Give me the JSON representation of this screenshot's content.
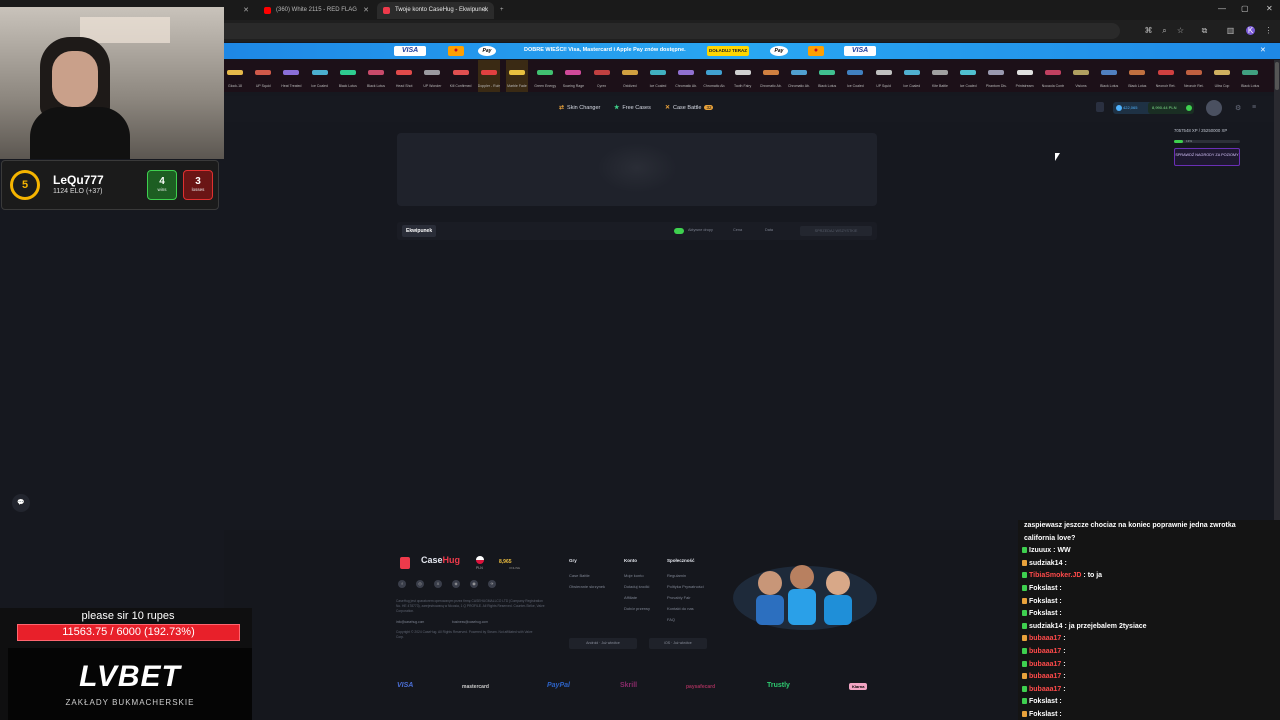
{
  "browser": {
    "tabs": [
      {
        "label": "",
        "active": false
      },
      {
        "label": "(360) White 2115 - RED FLAG",
        "active": false
      },
      {
        "label": "Twoje konto CaseHug - Ekwipunek",
        "active": true
      }
    ],
    "new_tab": "+"
  },
  "banner": {
    "text": "DOBRE WIEŚCI! Visa, Mastercard i Apple Pay znów dostępne.",
    "button": "DOŁADUJ TERAZ",
    "cards": [
      "VISA",
      "Pay",
      "Pay",
      "VISA"
    ]
  },
  "skins": [
    {
      "name": "Glock-18",
      "color": "#e6b84a"
    },
    {
      "name": "UP Squid",
      "color": "#d05a4a"
    },
    {
      "name": "Heat Treated",
      "color": "#8a6fd8"
    },
    {
      "name": "Ice Coaled",
      "color": "#4bb0d0"
    },
    {
      "name": "Black Lotus",
      "color": "#2ecc90"
    },
    {
      "name": "Black Lotus",
      "color": "#c84a6a"
    },
    {
      "name": "Head Shot",
      "color": "#e04a4a"
    },
    {
      "name": "UP Wonder",
      "color": "#9a9aa0"
    },
    {
      "name": "Kill Confirmed",
      "color": "#e05050"
    },
    {
      "name": "Doppler - Ruby",
      "color": "#e04040"
    },
    {
      "name": "Marble Fade",
      "color": "#e8c040"
    },
    {
      "name": "Green Energy",
      "color": "#40c070"
    },
    {
      "name": "Soaring Rage",
      "color": "#d04a9a"
    },
    {
      "name": "Cyrex",
      "color": "#c04040"
    },
    {
      "name": "Oxidized",
      "color": "#d0a040"
    },
    {
      "name": "Ice Coaled",
      "color": "#40b0c0"
    },
    {
      "name": "Chromatic Ab.",
      "color": "#9070d0"
    },
    {
      "name": "Chromatic Ab.",
      "color": "#40a0d0"
    },
    {
      "name": "Tooth Fairy",
      "color": "#d0d0d0"
    },
    {
      "name": "Chromatic Ab.",
      "color": "#d08040"
    },
    {
      "name": "Chromatic Ab.",
      "color": "#50a0d0"
    },
    {
      "name": "Black Lotus",
      "color": "#40c090"
    },
    {
      "name": "Ice Coaled",
      "color": "#4080c0"
    },
    {
      "name": "UP Squid",
      "color": "#c0c0c0"
    },
    {
      "name": "Ice Coaled",
      "color": "#50b0d0"
    },
    {
      "name": "Kite Battle",
      "color": "#a0a0a0"
    },
    {
      "name": "Ice Coaled",
      "color": "#50c0d0"
    },
    {
      "name": "Phantom Dis.",
      "color": "#9a9ab0"
    },
    {
      "name": "Printstream",
      "color": "#e0e0e0"
    },
    {
      "name": "Nocaola Control",
      "color": "#c04060"
    },
    {
      "name": "Visions",
      "color": "#b0a060"
    },
    {
      "name": "Black Lotus",
      "color": "#5080c0"
    },
    {
      "name": "Black Lotus",
      "color": "#c07040"
    },
    {
      "name": "Neonoir Ret.",
      "color": "#d04040"
    },
    {
      "name": "Neonoir Ret.",
      "color": "#c06040"
    },
    {
      "name": "Ultra Cop",
      "color": "#d0b060"
    },
    {
      "name": "Black Lotus",
      "color": "#40a080"
    }
  ],
  "nav": {
    "links": [
      "Skin Changer",
      "Free Cases",
      "Case Battle"
    ],
    "battle_count": "32",
    "balance_coins": "422,065",
    "balance_pln": "8,990.44 PLN"
  },
  "xp": {
    "value": "7057548 XP / 25250000 XP",
    "percent": "13%",
    "button": "SPRAWDŹ NAGRODY ZA POZIOMY"
  },
  "inventory": {
    "tab": "Ekwipunek",
    "active_toggle": "Aktywne dropy",
    "sort1": "Cena",
    "sort2": "Data",
    "sell_all": "SPRZEDAJ WSZYSTKIE"
  },
  "footer": {
    "brand": "Case",
    "brand_accent": "Hug",
    "lang": "PLN",
    "online": "8,965",
    "online_label": "ONLINE",
    "cols": [
      {
        "head": "Gry",
        "links": [
          "Case Battle",
          "Otwieranie skrzynek"
        ]
      },
      {
        "head": "Konto",
        "links": [
          "Moje konto",
          "Doładuj środki",
          "Affiliate",
          "Dobór przerwy"
        ]
      },
      {
        "head": "Społeczność",
        "links": [
          "Regulamin",
          "Polityka Prywatności",
          "Provably Fair",
          "Kontakt do nas",
          "FAQ"
        ]
      }
    ],
    "legal": "CaseHug jest oparatorem operowanym przez firmę CASEHUGMALLCO LTD (Company Registration No. HE 478773), zarejestrowaną w Nicosia, 1 Q PROFILE. All Rights Reserved. Counter-Strike, Valve Corporation.",
    "email1": "info@casehug.com",
    "email2": "business@casehug.com",
    "copyright": "Copyright © 2024 CaseHug. All Rights Reserved. Powered by Steam. Not affiliated with Valve Corp.",
    "app1": "Android · Już wkrótce",
    "app2": "iOS · Już wkrótce",
    "payments": [
      "VISA",
      "mastercard",
      "PayPal",
      "Skrill",
      "paysafecard",
      "Trustly",
      "Klarna"
    ],
    "social": [
      "f",
      "◎",
      "X",
      "◈",
      "◉",
      "✈"
    ]
  },
  "stream": {
    "level": "5",
    "username": "LeQu777",
    "elo": "1124 ELO (+37)",
    "wins": "4",
    "wins_label": "wins",
    "losses": "3",
    "losses_label": "losses",
    "donation_text": "please sir 10 rupes",
    "donation_goal": "11563.75 / 6000 (192.73%)",
    "sponsor": "LVBET",
    "sponsor_sub": "ZAKŁADY BUKMACHERSKIE"
  },
  "chat": [
    {
      "user": "",
      "msg": "zaspiewasz jeszcze chociaz na koniec poprawnie jedna zwrotka",
      "color": "#6c8cff"
    },
    {
      "user": "",
      "msg": "california love?",
      "color": "#ffffff"
    },
    {
      "user": "Izuuux",
      "msg": "WW",
      "color": "#ffffff"
    },
    {
      "user": "sudziak14",
      "msg": "",
      "color": "#ffffff"
    },
    {
      "user": "TibiaSmoker.JD",
      "msg": "to ja",
      "color": "#ff4a4a"
    },
    {
      "user": "Fokslast",
      "msg": "",
      "color": "#ffffff"
    },
    {
      "user": "Fokslast",
      "msg": "",
      "color": "#ffffff"
    },
    {
      "user": "Fokslast",
      "msg": "",
      "color": "#ffffff"
    },
    {
      "user": "sudziak14",
      "msg": "ja przejebalem 2tysiace",
      "color": "#ffffff"
    },
    {
      "user": "bubaaa17",
      "msg": "",
      "color": "#ff4a4a"
    },
    {
      "user": "bubaaa17",
      "msg": "",
      "color": "#ff4a4a"
    },
    {
      "user": "bubaaa17",
      "msg": "",
      "color": "#ff4a4a"
    },
    {
      "user": "bubaaa17",
      "msg": "",
      "color": "#ff4a4a"
    },
    {
      "user": "bubaaa17",
      "msg": "",
      "color": "#ff4a4a"
    },
    {
      "user": "Fokslast",
      "msg": "",
      "color": "#ffffff"
    },
    {
      "user": "Fokslast",
      "msg": "",
      "color": "#ffffff"
    }
  ]
}
